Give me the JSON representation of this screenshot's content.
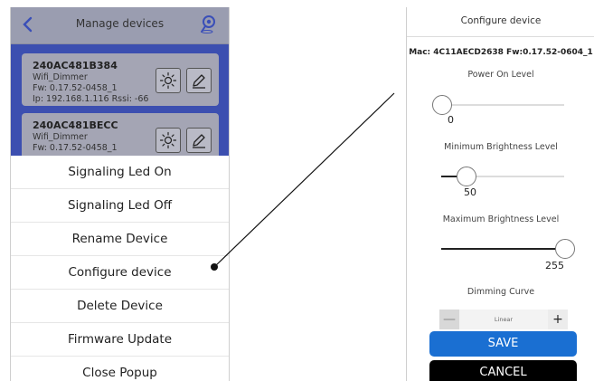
{
  "left": {
    "header": {
      "title": "Manage devices",
      "back_icon": "chevron-left-icon",
      "action_icon": "location-pin-icon"
    },
    "devices": [
      {
        "name": "240AC481B384",
        "type": "Wifi_Dimmer",
        "fw": "Fw: 0.17.52-0458_1",
        "net": "Ip: 192.168.1.116   Rssi: -66"
      },
      {
        "name": "240AC481BECC",
        "type": "Wifi_Dimmer",
        "fw": "Fw: 0.17.52-0458_1"
      }
    ],
    "popup": [
      "Signaling Led On",
      "Signaling Led Off",
      "Rename Device",
      "Configure device",
      "Delete Device",
      "Firmware Update",
      "Close Popup"
    ]
  },
  "right": {
    "title": "Configure device",
    "mac_line": "Mac: 4C11AECD2638 Fw:0.17.52-0604_1",
    "power_on": {
      "label": "Power On Level",
      "value": 0,
      "display": "0",
      "min": 0,
      "max": 255
    },
    "min_brightness": {
      "label": "Minimum Brightness Level",
      "value": 50,
      "display": "50",
      "min": 0,
      "max": 255
    },
    "max_brightness": {
      "label": "Maximum Brightness Level",
      "value": 255,
      "display": "255",
      "min": 0,
      "max": 255
    },
    "dimming": {
      "label": "Dimming Curve",
      "value": "Linear",
      "minus": "—",
      "plus": "+"
    },
    "save_label": "SAVE",
    "cancel_label": "CANCEL"
  },
  "colors": {
    "accent": "#1a6fd2",
    "device_list_bg": "#3c4fb0",
    "header_bg": "#9a9db0",
    "cancel_bg": "#000000"
  }
}
